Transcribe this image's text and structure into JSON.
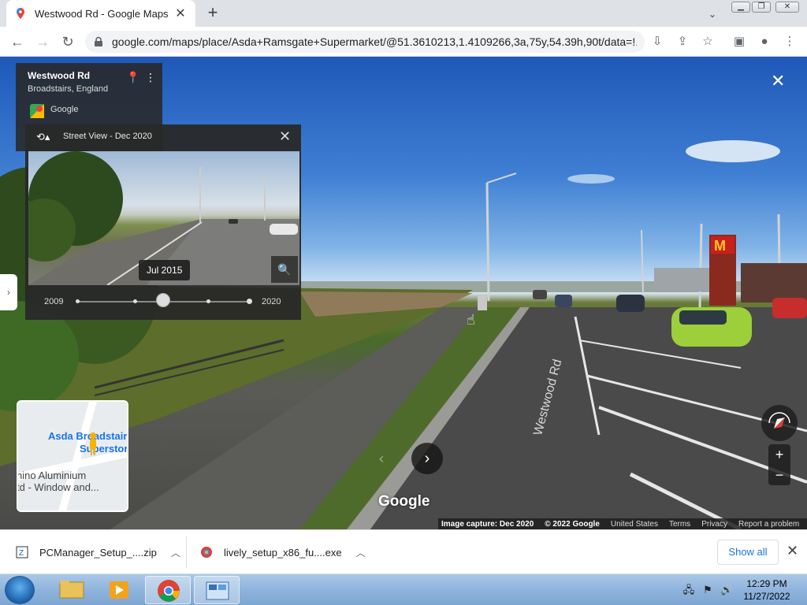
{
  "browser": {
    "tab_title": "Westwood Rd - Google Maps",
    "url": "google.com/maps/place/Asda+Ramsgate+Supermarket/@51.3610213,1.4109266,3a,75y,54.39h,90t/data=!..."
  },
  "place_card": {
    "name": "Westwood Rd",
    "subtitle": "Broadstairs, England",
    "source": "Google"
  },
  "time_machine": {
    "header": "Street View - Dec 2020",
    "selected_date": "Jul 2015",
    "range_start": "2009",
    "range_end": "2020",
    "selected_fraction": 0.5
  },
  "minimap": {
    "label_1": "Asda Broadstair",
    "label_2": "Superstor",
    "label_3": "hino Aluminium",
    "label_4": "td - Window and..."
  },
  "street_view": {
    "logo": "Google",
    "road_label": "Westwood Rd"
  },
  "footer": {
    "capture": "Image capture: Dec 2020",
    "copyright": "© 2022 Google",
    "country": "United States",
    "terms": "Terms",
    "privacy": "Privacy",
    "report": "Report a problem"
  },
  "downloads": {
    "items": [
      {
        "name": "PCManager_Setup_....zip"
      },
      {
        "name": "lively_setup_x86_fu....exe"
      }
    ],
    "show_all": "Show all"
  },
  "taskbar": {
    "time": "12:29 PM",
    "date": "11/27/2022"
  },
  "colors": {
    "accent": "#1a73e8",
    "panel": "#282828"
  }
}
